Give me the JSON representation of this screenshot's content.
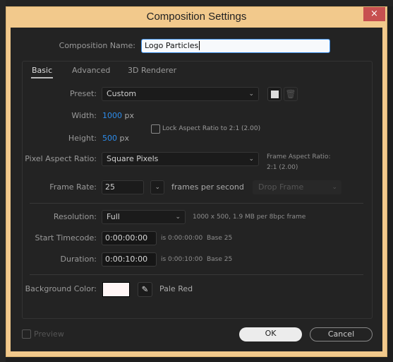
{
  "dialog": {
    "title": "Composition Settings",
    "close_label": "×"
  },
  "name": {
    "label": "Composition Name:",
    "value": "Logo Particles"
  },
  "tabs": [
    {
      "label": "Basic",
      "active": true
    },
    {
      "label": "Advanced"
    },
    {
      "label": "3D Renderer"
    }
  ],
  "preset": {
    "label": "Preset:",
    "value": "Custom"
  },
  "width": {
    "label": "Width:",
    "value": "1000",
    "unit": "px"
  },
  "height": {
    "label": "Height:",
    "value": "500",
    "unit": "px"
  },
  "lock": {
    "label": "Lock Aspect Ratio to 2:1 (2.00)",
    "checked": false
  },
  "pixel_aspect": {
    "label": "Pixel Aspect Ratio:",
    "value": "Square Pixels",
    "frame_aspect_label": "Frame Aspect Ratio:",
    "frame_aspect_value": "2:1 (2.00)"
  },
  "frame_rate": {
    "label": "Frame Rate:",
    "value": "25",
    "unit": "frames per second",
    "drop_frame": "Drop Frame"
  },
  "resolution": {
    "label": "Resolution:",
    "value": "Full",
    "info": "1000 x 500, 1.9 MB per 8bpc frame"
  },
  "start_timecode": {
    "label": "Start Timecode:",
    "value": "0:00:00:00",
    "info": "is 0:00:00:00",
    "base": "Base 25"
  },
  "duration": {
    "label": "Duration:",
    "value": "0:00:10:00",
    "info": "is 0:00:10:00",
    "base": "Base 25"
  },
  "background": {
    "label": "Background Color:",
    "color": "#fff5f5",
    "name": "Pale Red"
  },
  "footer": {
    "preview": "Preview",
    "ok": "OK",
    "cancel": "Cancel"
  },
  "colors": {
    "title_bar": "#f2c98c",
    "close": "#c75050",
    "accent": "#2d8ceb"
  }
}
